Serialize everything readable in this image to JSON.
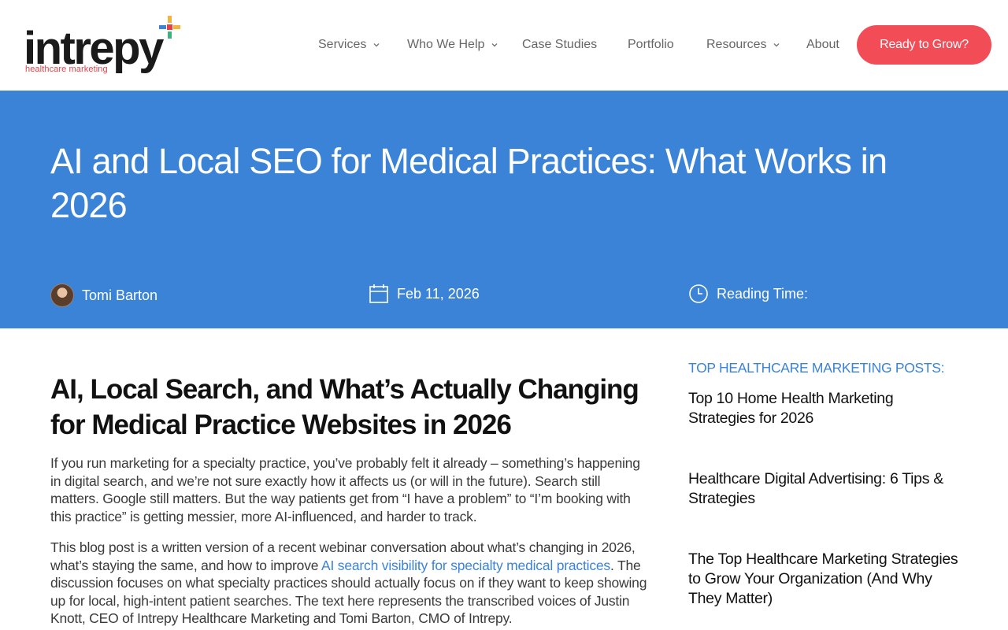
{
  "logo": {
    "word": "intrepy",
    "tagline": "healthcare marketing",
    "plus_colors": [
      "#f2b53a",
      "#e83e45",
      "#3b83d6",
      "#3bb37a"
    ]
  },
  "nav": {
    "items": [
      {
        "label": "Services",
        "has_dropdown": true
      },
      {
        "label": "Who We Help",
        "has_dropdown": true
      },
      {
        "label": "Case Studies",
        "has_dropdown": false
      },
      {
        "label": "Portfolio",
        "has_dropdown": false
      },
      {
        "label": "Resources",
        "has_dropdown": true
      },
      {
        "label": "About",
        "has_dropdown": false
      }
    ],
    "cta": "Ready to Grow?"
  },
  "hero": {
    "title": "AI and Local SEO for Medical Practices: What Works in 2026",
    "author": "Tomi Barton",
    "date": "Feb 11, 2026",
    "reading_time_label": "Reading Time:"
  },
  "article": {
    "heading": "AI, Local Search, and What’s Actually Changing for Medical Practice Websites in 2026",
    "p1": "If you run marketing for a specialty practice, you’ve probably felt it already – something’s happening in digital search, and we’re not sure exactly how it affects us (or will in the future). Search still matters. Google still matters. But the way patients get from “I have a problem” to “I’m booking with this practice” is getting messier, more AI-influenced, and harder to track.",
    "p2_before": "This blog post is a written version of a recent webinar conversation about what’s changing in 2026, what’s staying the same, and how to improve ",
    "p2_link": "AI search visibility for specialty medical practices",
    "p2_after": ". The discussion focuses on what specialty practices should actually focus on if they want to keep showing up for local, high-intent patient searches. The text here represents the transcribed voices of Justin Knott, CEO of Intrepy Healthcare Marketing and Tomi Barton, CMO of Intrepy."
  },
  "sidebar": {
    "heading": "TOP HEALTHCARE MARKETING POSTS:",
    "posts": [
      "Top 10 Home Health Marketing Strategies for 2026",
      "Healthcare Digital Advertising: 6 Tips & Strategies",
      "The Top Healthcare Marketing Strategies to Grow Your Organization (And Why They Matter)"
    ]
  },
  "colors": {
    "accent_blue": "#3b83d6",
    "cta_red": "#f24c57"
  }
}
